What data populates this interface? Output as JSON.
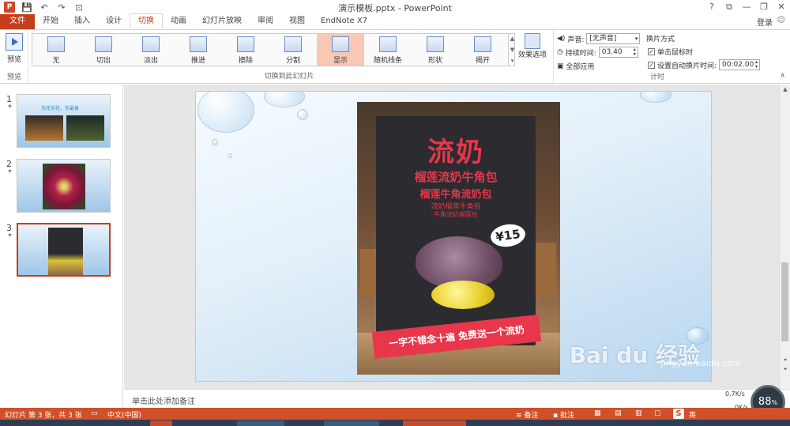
{
  "window": {
    "title": "演示模板.pptx - PowerPoint",
    "app_badge": "P",
    "controls": [
      "?",
      "⧉",
      "—",
      "❐",
      "✕"
    ]
  },
  "quick_access": [
    "💾",
    "↶",
    "↷",
    "⊡"
  ],
  "tabs": {
    "file": "文件",
    "items": [
      "开始",
      "插入",
      "设计",
      "切换",
      "动画",
      "幻灯片放映",
      "审阅",
      "视图",
      "EndNote X7"
    ],
    "active": "切换",
    "login": "登录"
  },
  "ribbon": {
    "preview": {
      "label": "预览",
      "group": "预览"
    },
    "transitions": {
      "group": "切换到此幻灯片",
      "items": [
        {
          "label": "无"
        },
        {
          "label": "切出"
        },
        {
          "label": "淡出"
        },
        {
          "label": "推进"
        },
        {
          "label": "擦除"
        },
        {
          "label": "分割"
        },
        {
          "label": "显示",
          "selected": true
        },
        {
          "label": "随机线条"
        },
        {
          "label": "形状"
        },
        {
          "label": "揭开"
        }
      ],
      "effect_options": "效果选项"
    },
    "timing": {
      "group": "计时",
      "sound_label": "声音:",
      "sound_value": "[无声音]",
      "duration_label": "持续时间:",
      "duration_value": "03.40",
      "apply_all": "全部应用",
      "advance_title": "换片方式",
      "on_click": "单击鼠标时",
      "on_click_checked": true,
      "after": "设置自动换片时间:",
      "after_checked": true,
      "after_value": "00:02.00"
    }
  },
  "slides": [
    {
      "num": "1",
      "star": "*",
      "caption": "苏花苏花，你最香"
    },
    {
      "num": "2",
      "star": "*"
    },
    {
      "num": "3",
      "star": "*",
      "active": true
    }
  ],
  "slide": {
    "poster_title": "流奶",
    "poster_sub1": "榴莲流奶牛角包",
    "poster_sub2": "榴莲牛角流奶包",
    "poster_sub3": "流奶榴莲牛角包",
    "poster_sub4": "牛角流奶榴莲包",
    "price": "¥15",
    "banner": "一字不错念十遍 免费送一个流奶",
    "watermark": "Bai du 经验",
    "watermark_url": "jingyan.baidu.com"
  },
  "notes_placeholder": "单击此处添加备注",
  "speed": {
    "percent": "88",
    "percent_sign": "%",
    "up": "0.7K/s",
    "down": "0K/s"
  },
  "status": {
    "slide_info": "幻灯片 第 3 张，共 3 张",
    "language": "中文(中国)",
    "notes": "备注",
    "comments": "批注",
    "ime": "S",
    "ime_mode": "英"
  },
  "colors": {
    "accent": "#c43e1c",
    "statusbar": "#d0502a",
    "poster_red": "#e8364a"
  }
}
